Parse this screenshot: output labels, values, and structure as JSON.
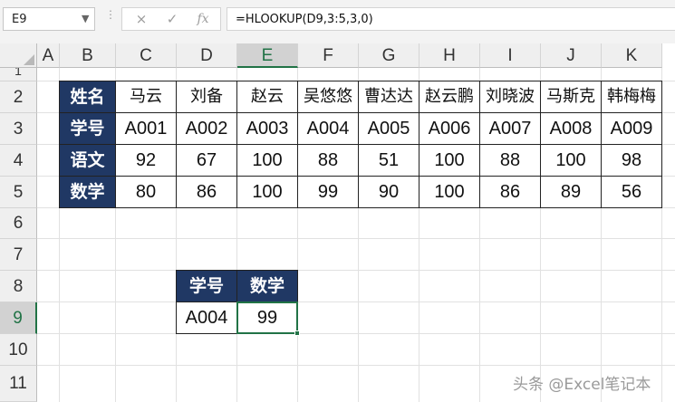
{
  "name_box": "E9",
  "formula_bar": {
    "cancel_icon": "×",
    "enter_icon": "✓",
    "fx_label": "fx",
    "formula": "=HLOOKUP(D9,3:5,3,0)"
  },
  "columns": [
    "A",
    "B",
    "C",
    "D",
    "E",
    "F",
    "G",
    "H",
    "I",
    "J",
    "K"
  ],
  "rows": [
    "1",
    "2",
    "3",
    "4",
    "5",
    "6",
    "7",
    "8",
    "9",
    "10",
    "11"
  ],
  "selected_column": "E",
  "selected_row": "9",
  "main_table": {
    "row_labels": [
      "姓名",
      "学号",
      "语文",
      "数学"
    ],
    "names": [
      "马云",
      "刘备",
      "赵云",
      "吴悠悠",
      "曹达达",
      "赵云鹏",
      "刘晓波",
      "马斯克",
      "韩梅梅"
    ],
    "ids": [
      "A001",
      "A002",
      "A003",
      "A004",
      "A005",
      "A006",
      "A007",
      "A008",
      "A009"
    ],
    "chinese": [
      "92",
      "67",
      "100",
      "88",
      "51",
      "100",
      "88",
      "100",
      "98"
    ],
    "math": [
      "80",
      "86",
      "100",
      "99",
      "90",
      "100",
      "86",
      "89",
      "56"
    ]
  },
  "lookup_table": {
    "headers": [
      "学号",
      "数学"
    ],
    "id_value": "A004",
    "result": "99"
  },
  "watermark": "头条 @Excel笔记本",
  "colors": {
    "header_fill": "#203864",
    "selection_green": "#217346"
  }
}
